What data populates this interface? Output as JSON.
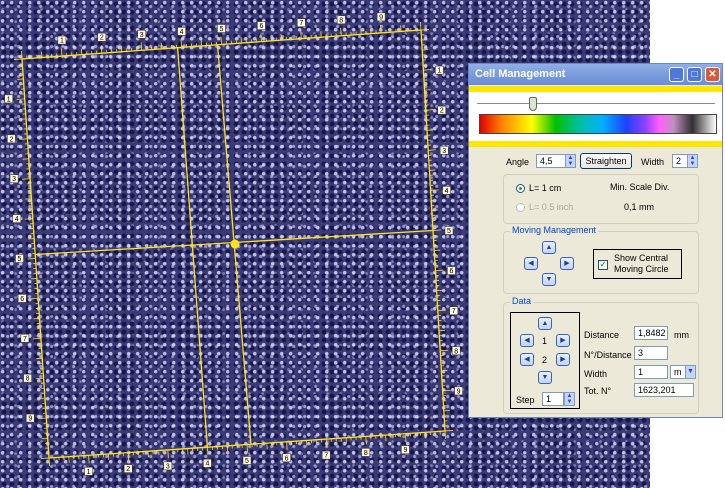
{
  "window": {
    "title": "Cell Management",
    "minimize_glyph": "_",
    "maximize_glyph": "□",
    "close_glyph": "✕"
  },
  "colors": {
    "grid": "#ffe21a",
    "fabric_base": "#3a3a7a",
    "title_bar": "#7c9ddc",
    "group_title": "#0046d5"
  },
  "controls": {
    "angle_label": "Angle",
    "angle_value": "4,5",
    "straighten_label": "Straighten",
    "width_label": "Width",
    "width_value": "2"
  },
  "scale": {
    "option1": "L= 1 cm",
    "option2": "L= 0.5 inch",
    "min_scale_label": "Min. Scale Div.",
    "min_scale_value": "0,1 mm"
  },
  "moving": {
    "title": "Moving Management",
    "checkbox_label": "Show Central Moving Circle",
    "checked": true
  },
  "data_group": {
    "title": "Data",
    "counter1": "1",
    "counter2": "2",
    "step_label": "Step",
    "step_value": "1",
    "distance_label": "Distance",
    "distance_value": "1,8482",
    "distance_unit": "mm",
    "ndist_label": "N°/Distance",
    "ndist_value": "3",
    "width_label": "Width",
    "width_value": "1",
    "width_unit": "m",
    "tot_label": "Tot. N°",
    "tot_value": "1623,201"
  },
  "grid_labels": {
    "top": [
      "1",
      "2",
      "3",
      "4",
      "5",
      "6",
      "7",
      "8",
      "9"
    ],
    "bottom": [
      "1",
      "2",
      "3",
      "4",
      "5",
      "6",
      "7",
      "8",
      "9"
    ],
    "left": [
      "1",
      "2",
      "3",
      "4",
      "5",
      "6",
      "7",
      "8",
      "9"
    ],
    "right": [
      "1",
      "2",
      "3",
      "4",
      "5",
      "6",
      "7",
      "8",
      "9"
    ]
  }
}
